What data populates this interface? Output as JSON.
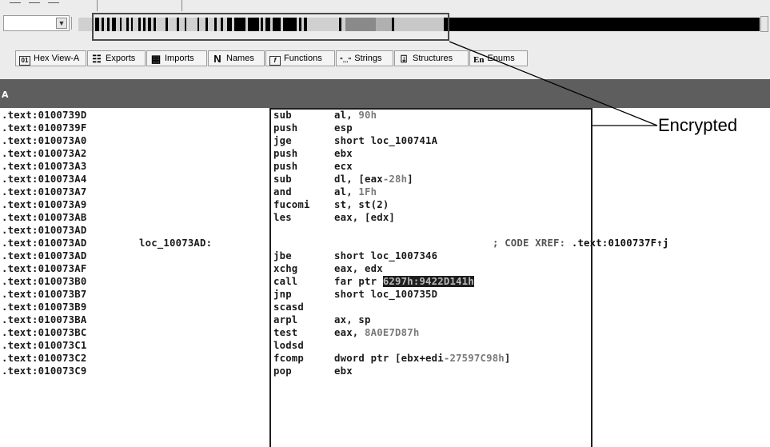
{
  "tabs": [
    {
      "label": "Hex View-A",
      "icon": "hex-icon"
    },
    {
      "label": "Exports",
      "icon": "exports-icon"
    },
    {
      "label": "Imports",
      "icon": "imports-icon"
    },
    {
      "label": "Names",
      "icon": "names-icon",
      "glyph": "N"
    },
    {
      "label": "Functions",
      "icon": "functions-icon",
      "glyph": "f"
    },
    {
      "label": "Strings",
      "icon": "strings-icon",
      "glyph": "\"...\""
    },
    {
      "label": "Structures",
      "icon": "structures-icon"
    },
    {
      "label": "Enums",
      "icon": "enums-icon",
      "glyph": "En"
    }
  ],
  "view_title": "A",
  "annotation": {
    "label": "Encrypted"
  },
  "listing": [
    {
      "addr": ".text:0100739D",
      "label": "",
      "mnem": "sub",
      "ops": "al, ",
      "num": "90h"
    },
    {
      "addr": ".text:0100739F",
      "label": "",
      "mnem": "push",
      "ops": "esp",
      "num": ""
    },
    {
      "addr": ".text:010073A0",
      "label": "",
      "mnem": "jge",
      "ops": "short loc_100741A",
      "num": ""
    },
    {
      "addr": ".text:010073A2",
      "label": "",
      "mnem": "push",
      "ops": "ebx",
      "num": ""
    },
    {
      "addr": ".text:010073A3",
      "label": "",
      "mnem": "push",
      "ops": "ecx",
      "num": ""
    },
    {
      "addr": ".text:010073A4",
      "label": "",
      "mnem": "sub",
      "ops": "dl, [eax",
      "num": "-28h",
      "tail": "]"
    },
    {
      "addr": ".text:010073A7",
      "label": "",
      "mnem": "and",
      "ops": "al, ",
      "num": "1Fh"
    },
    {
      "addr": ".text:010073A9",
      "label": "",
      "mnem": "fucomi",
      "ops": "st, st(2)",
      "num": ""
    },
    {
      "addr": ".text:010073AB",
      "label": "",
      "mnem": "les",
      "ops": "eax, [edx]",
      "num": ""
    },
    {
      "addr": ".text:010073AD",
      "label": "",
      "mnem": "",
      "ops": "",
      "num": ""
    },
    {
      "addr": ".text:010073AD",
      "label": "loc_10073AD:",
      "mnem": "",
      "ops": "",
      "num": "",
      "comment": "; CODE XREF: ",
      "xref": ".text:0100737F↑j"
    },
    {
      "addr": ".text:010073AD",
      "label": "",
      "mnem": "jbe",
      "ops": "short loc_1007346",
      "num": ""
    },
    {
      "addr": ".text:010073AF",
      "label": "",
      "mnem": "xchg",
      "ops": "eax, edx",
      "num": ""
    },
    {
      "addr": ".text:010073B0",
      "label": "",
      "mnem": "call",
      "ops": "far ptr ",
      "num": "",
      "highlight": "6297h:9422D141h"
    },
    {
      "addr": ".text:010073B7",
      "label": "",
      "mnem": "jnp",
      "ops": "short loc_100735D",
      "num": ""
    },
    {
      "addr": ".text:010073B9",
      "label": "",
      "mnem": "scasd",
      "ops": "",
      "num": ""
    },
    {
      "addr": ".text:010073BA",
      "label": "",
      "mnem": "arpl",
      "ops": "ax, sp",
      "num": ""
    },
    {
      "addr": ".text:010073BC",
      "label": "",
      "mnem": "test",
      "ops": "eax, ",
      "num": "8A0E7D87h"
    },
    {
      "addr": ".text:010073C1",
      "label": "",
      "mnem": "lodsd",
      "ops": "",
      "num": ""
    },
    {
      "addr": ".text:010073C2",
      "label": "",
      "mnem": "fcomp",
      "ops": "dword ptr [ebx+edi",
      "num": "-27597C98h",
      "tail": "]"
    },
    {
      "addr": ".text:010073C9",
      "label": "",
      "mnem": "pop",
      "ops": "ebx",
      "num": ""
    }
  ]
}
